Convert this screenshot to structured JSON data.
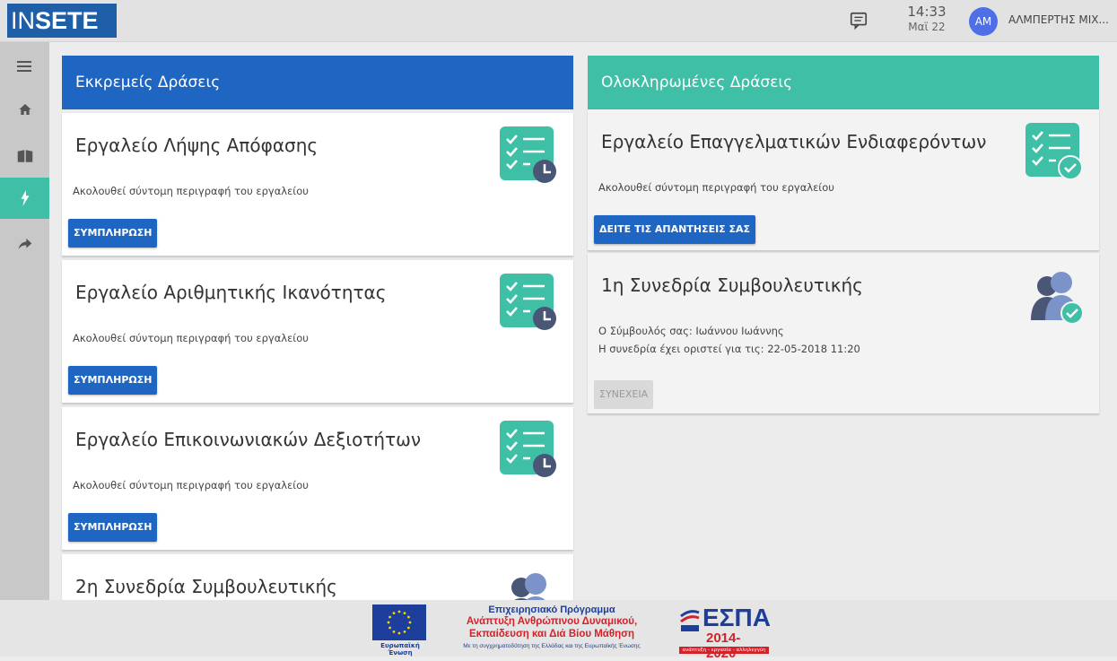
{
  "topbar": {
    "logo_light": "IN",
    "logo_bold": "SETE",
    "time": "14:33",
    "date": "Μαϊ 22",
    "avatar_initials": "AM",
    "username": "ΑΛΜΠΕΡΤΗΣ ΜΙΧ..."
  },
  "rail": {
    "items": [
      "menu-icon",
      "home-icon",
      "book-icon",
      "bolt-icon",
      "share-icon"
    ],
    "active_index": 3
  },
  "pending": {
    "header": "Εκκρεμείς Δράσεις",
    "cards": [
      {
        "title": "Εργαλείο Λήψης Απόφασης",
        "desc": "Ακολουθεί σύντομη περιγραφή του εργαλείου",
        "button": "ΣΥΜΠΛΗΡΩΣΗ"
      },
      {
        "title": "Εργαλείο Αριθμητικής Ικανότητας",
        "desc": "Ακολουθεί σύντομη περιγραφή του εργαλείου",
        "button": "ΣΥΜΠΛΗΡΩΣΗ"
      },
      {
        "title": "Εργαλείο Επικοινωνιακών Δεξιοτήτων",
        "desc": "Ακολουθεί σύντομη περιγραφή του εργαλείου",
        "button": "ΣΥΜΠΛΗΡΩΣΗ"
      },
      {
        "title": "2η Συνεδρία Συμβουλευτικής"
      }
    ]
  },
  "completed": {
    "header": "Ολοκληρωμένες Δράσεις",
    "cards": [
      {
        "title": "Εργαλείο Επαγγελματικών Ενδιαφερόντων",
        "desc": "Ακολουθεί σύντομη περιγραφή του εργαλείου",
        "button": "ΔΕΙΤΕ ΤΙΣ ΑΠΑΝΤΗΣΕΙΣ ΣΑΣ"
      },
      {
        "title": "1η Συνεδρία Συμβουλευτικής",
        "desc": "Ο Σύμβουλός σας: Ιωάννου Ιωάννης",
        "desc2": "Η συνεδρία έχει οριστεί για τις: 22-05-2018 11:20",
        "button": "ΣΥΝΕΧΕΙΑ"
      }
    ]
  },
  "footer": {
    "eu_caption": "Ευρωπαϊκή Ένωση",
    "op_line1": "Επιχειρησιακό Πρόγραμμα",
    "op_line2": "Ανάπτυξη Ανθρώπινου Δυναμικού,",
    "op_line3": "Εκπαίδευση και Διά Βίου Μάθηση",
    "op_line4": "Με τη συγχρηματοδότηση της Ελλάδας και της Ευρωπαϊκής Ένωσης",
    "espa_title": "ΕΣΠΑ",
    "espa_years": "2014-2020",
    "espa_tagline": "ανάπτυξη - εργασία - αλληλεγγύη"
  },
  "colors": {
    "primary": "#1e66c2",
    "accent": "#3fbfa6",
    "icon_clock": "#4a5675"
  }
}
